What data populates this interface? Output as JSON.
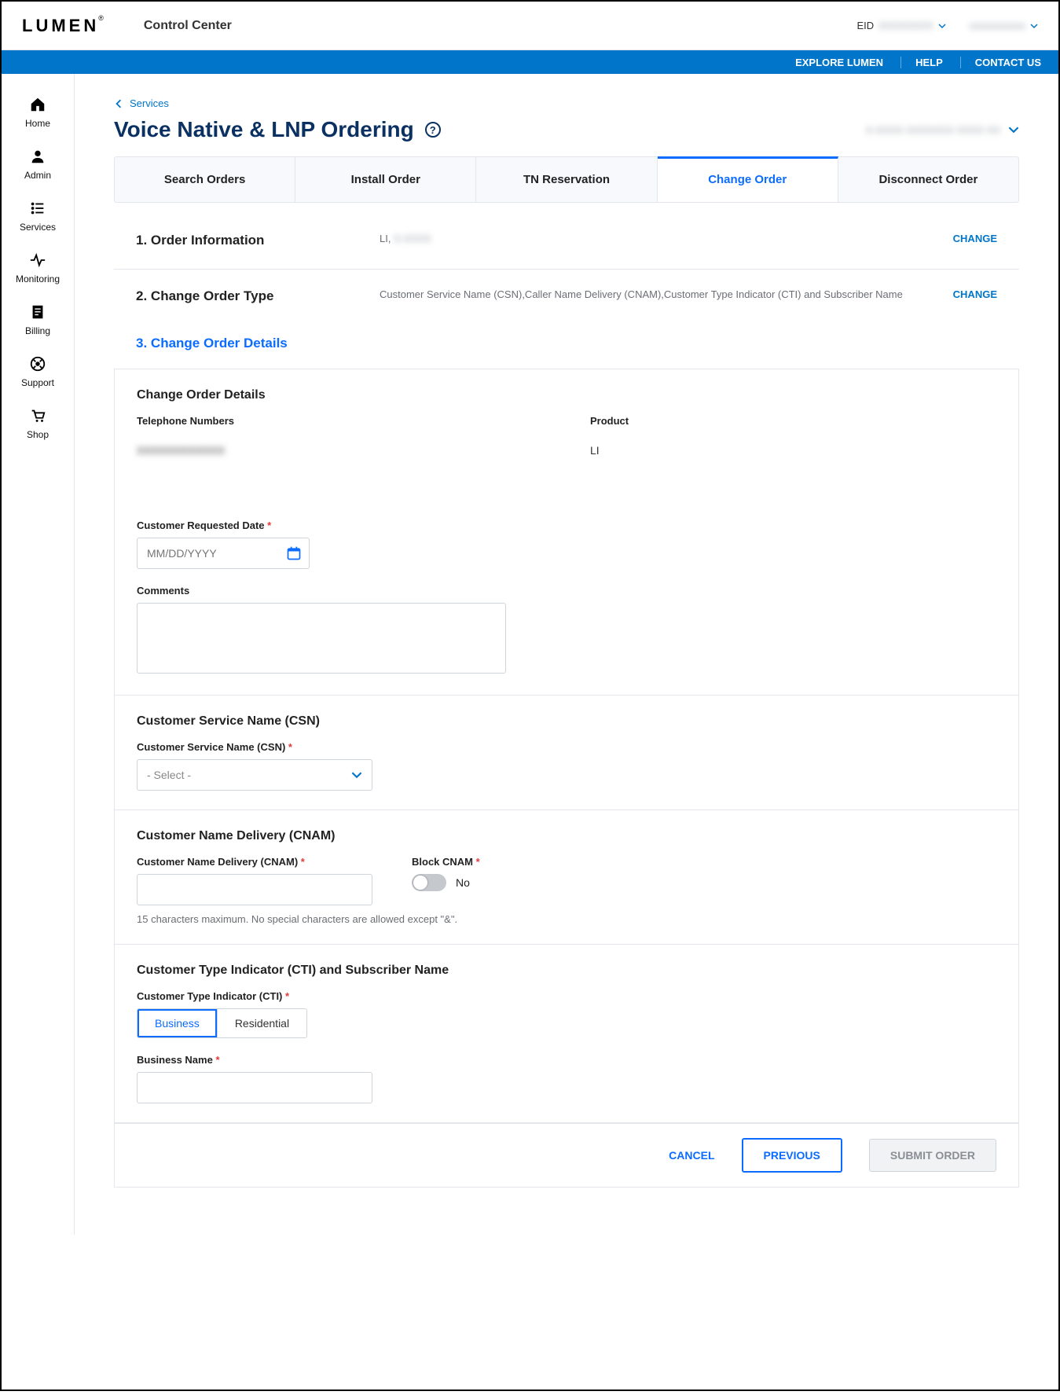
{
  "header": {
    "logo_text": "LUMEN",
    "logo_mark": "®",
    "app_name": "Control Center",
    "eid_label": "EID",
    "eid_value": "XXXXXXXX",
    "user_value": "xxxxxxxxxxx"
  },
  "bluebar": {
    "explore": "EXPLORE LUMEN",
    "help": "HELP",
    "contact": "CONTACT US"
  },
  "sidenav": [
    {
      "key": "home",
      "label": "Home"
    },
    {
      "key": "admin",
      "label": "Admin"
    },
    {
      "key": "services",
      "label": "Services"
    },
    {
      "key": "monitoring",
      "label": "Monitoring"
    },
    {
      "key": "billing",
      "label": "Billing"
    },
    {
      "key": "support",
      "label": "Support"
    },
    {
      "key": "shop",
      "label": "Shop"
    }
  ],
  "breadcrumb": {
    "parent": "Services"
  },
  "page": {
    "title": "Voice Native & LNP Ordering",
    "account_selected": "X-XXXX   XXXXXXX  XXXX  XX"
  },
  "tabs": [
    {
      "key": "search",
      "label": "Search Orders"
    },
    {
      "key": "install",
      "label": "Install Order"
    },
    {
      "key": "tn",
      "label": "TN Reservation"
    },
    {
      "key": "change",
      "label": "Change Order",
      "active": true
    },
    {
      "key": "disconnect",
      "label": "Disconnect Order"
    }
  ],
  "steps": {
    "s1": {
      "num": "1.",
      "title": "Order Information",
      "value_prefix": "LI,",
      "value_blur": "X-XXXX",
      "action": "CHANGE"
    },
    "s2": {
      "num": "2.",
      "title": "Change Order Type",
      "value": "Customer Service Name (CSN),Caller Name Delivery (CNAM),Customer Type Indicator (CTI) and Subscriber Name",
      "action": "CHANGE"
    },
    "s3": {
      "num": "3.",
      "title": "Change Order Details"
    }
  },
  "details": {
    "heading": "Change Order Details",
    "tn_label": "Telephone Numbers",
    "tn_value": "XXXXXXXXXXXX",
    "product_label": "Product",
    "product_value": "LI",
    "crd_label": "Customer Requested Date",
    "crd_placeholder": "MM/DD/YYYY",
    "comments_label": "Comments",
    "comments_value": ""
  },
  "csn": {
    "heading": "Customer Service Name (CSN)",
    "field_label": "Customer Service Name (CSN)",
    "select_placeholder": "- Select -"
  },
  "cnam": {
    "heading": "Customer Name Delivery (CNAM)",
    "field_label": "Customer Name Delivery (CNAM)",
    "field_value": "",
    "block_label": "Block CNAM",
    "block_value": "No",
    "hint": "15 characters maximum. No special characters are allowed except \"&\"."
  },
  "cti": {
    "heading": "Customer Type Indicator (CTI) and Subscriber Name",
    "field_label": "Customer Type Indicator (CTI)",
    "option_business": "Business",
    "option_residential": "Residential",
    "selected": "Business",
    "name_label": "Business Name",
    "name_value": ""
  },
  "footer": {
    "cancel": "CANCEL",
    "previous": "PREVIOUS",
    "submit": "SUBMIT ORDER"
  }
}
